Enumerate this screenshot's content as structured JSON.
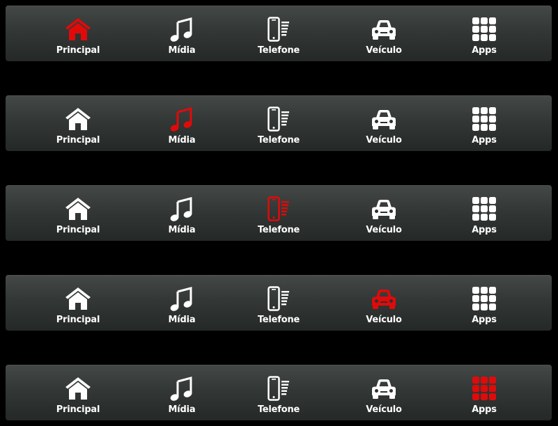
{
  "accent_color": "#e10a0a",
  "icon_color": "#ffffff",
  "bar_variants": [
    {
      "selected": "Principal",
      "items": [
        {
          "label": "Principal",
          "icon": "home-icon"
        },
        {
          "label": "Mídia",
          "icon": "music-note-icon"
        },
        {
          "label": "Telefone",
          "icon": "phone-icon"
        },
        {
          "label": "Veículo",
          "icon": "car-icon"
        },
        {
          "label": "Apps",
          "icon": "apps-grid-icon"
        }
      ]
    },
    {
      "selected": "Mídia",
      "items": [
        {
          "label": "Principal",
          "icon": "home-icon"
        },
        {
          "label": "Mídia",
          "icon": "music-note-icon"
        },
        {
          "label": "Telefone",
          "icon": "phone-icon"
        },
        {
          "label": "Veículo",
          "icon": "car-icon"
        },
        {
          "label": "Apps",
          "icon": "apps-grid-icon"
        }
      ]
    },
    {
      "selected": "Telefone",
      "items": [
        {
          "label": "Principal",
          "icon": "home-icon"
        },
        {
          "label": "Mídia",
          "icon": "music-note-icon"
        },
        {
          "label": "Telefone",
          "icon": "phone-icon"
        },
        {
          "label": "Veículo",
          "icon": "car-icon"
        },
        {
          "label": "Apps",
          "icon": "apps-grid-icon"
        }
      ]
    },
    {
      "selected": "Veículo",
      "items": [
        {
          "label": "Principal",
          "icon": "home-icon"
        },
        {
          "label": "Mídia",
          "icon": "music-note-icon"
        },
        {
          "label": "Telefone",
          "icon": "phone-icon"
        },
        {
          "label": "Veículo",
          "icon": "car-icon"
        },
        {
          "label": "Apps",
          "icon": "apps-grid-icon"
        }
      ]
    },
    {
      "selected": "Apps",
      "items": [
        {
          "label": "Principal",
          "icon": "home-icon"
        },
        {
          "label": "Mídia",
          "icon": "music-note-icon"
        },
        {
          "label": "Telefone",
          "icon": "phone-icon"
        },
        {
          "label": "Veículo",
          "icon": "car-icon"
        },
        {
          "label": "Apps",
          "icon": "apps-grid-icon"
        }
      ]
    }
  ]
}
